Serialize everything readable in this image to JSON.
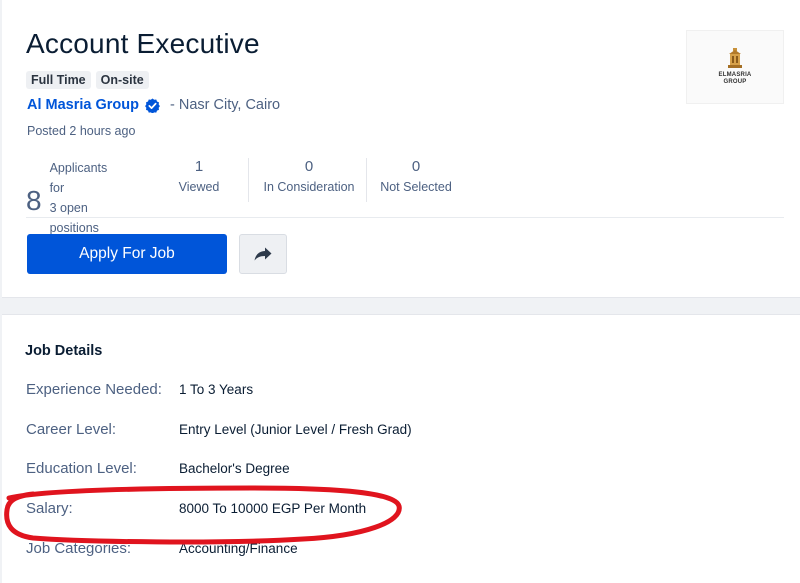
{
  "job": {
    "title": "Account Executive",
    "tags": [
      "Full Time",
      "On-site"
    ],
    "company": "Al Masria Group",
    "location": "- Nasr City, Cairo",
    "posted": "Posted 2 hours ago",
    "logo_text_line1": "ELMASRIA",
    "logo_text_line2": "GROUP"
  },
  "stats": {
    "applicants_count": "8",
    "applicants_line1": "Applicants for",
    "applicants_line2": "3 open positions",
    "viewed_value": "1",
    "viewed_label": "Viewed",
    "consideration_value": "0",
    "consideration_label": "In Consideration",
    "not_selected_value": "0",
    "not_selected_label": "Not Selected"
  },
  "actions": {
    "apply_label": "Apply For Job"
  },
  "details": {
    "section_title": "Job Details",
    "rows": [
      {
        "label": "Experience Needed:",
        "value": "1 To 3 Years"
      },
      {
        "label": "Career Level:",
        "value": "Entry Level (Junior Level / Fresh Grad)"
      },
      {
        "label": "Education Level:",
        "value": "Bachelor's Degree"
      },
      {
        "label": "Salary:",
        "value": "8000 To 10000 EGP Per Month"
      },
      {
        "label": "Job Categories:",
        "value": "Accounting/Finance"
      }
    ]
  },
  "colors": {
    "brand_blue": "#0055d9",
    "annotation_red": "#e0141e",
    "text_dark": "#0a1d33",
    "text_muted": "#4d6182"
  }
}
